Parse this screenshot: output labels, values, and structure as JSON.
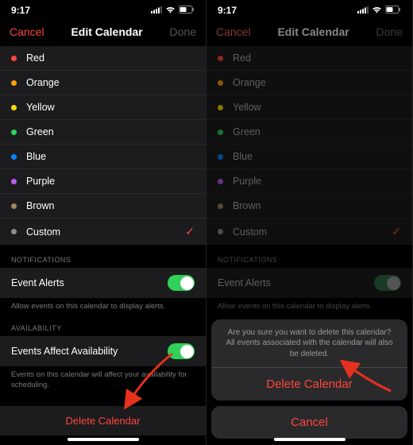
{
  "status": {
    "time": "9:17"
  },
  "nav": {
    "cancel": "Cancel",
    "title": "Edit Calendar",
    "done": "Done"
  },
  "colors": [
    {
      "key": "red",
      "label": "Red",
      "hex": "#ff453a"
    },
    {
      "key": "orange",
      "label": "Orange",
      "hex": "#ff9f0a"
    },
    {
      "key": "yellow",
      "label": "Yellow",
      "hex": "#ffd60a"
    },
    {
      "key": "green",
      "label": "Green",
      "hex": "#30d158"
    },
    {
      "key": "blue",
      "label": "Blue",
      "hex": "#0a84ff"
    },
    {
      "key": "purple",
      "label": "Purple",
      "hex": "#bf5af2"
    },
    {
      "key": "brown",
      "label": "Brown",
      "hex": "#a2845e"
    },
    {
      "key": "custom",
      "label": "Custom",
      "hex": "#8e8e93",
      "selected": true
    }
  ],
  "sections": {
    "notifications": {
      "header": "NOTIFICATIONS",
      "item": "Event Alerts",
      "footer": "Allow events on this calendar to display alerts."
    },
    "availability": {
      "header": "AVAILABILITY",
      "item": "Events Affect Availability",
      "footer": "Events on this calendar will affect your availability for scheduling."
    }
  },
  "delete": "Delete Calendar",
  "sheet": {
    "message": "Are you sure you want to delete this calendar? All events associated with the calendar will also be deleted.",
    "delete": "Delete Calendar",
    "cancel": "Cancel"
  }
}
